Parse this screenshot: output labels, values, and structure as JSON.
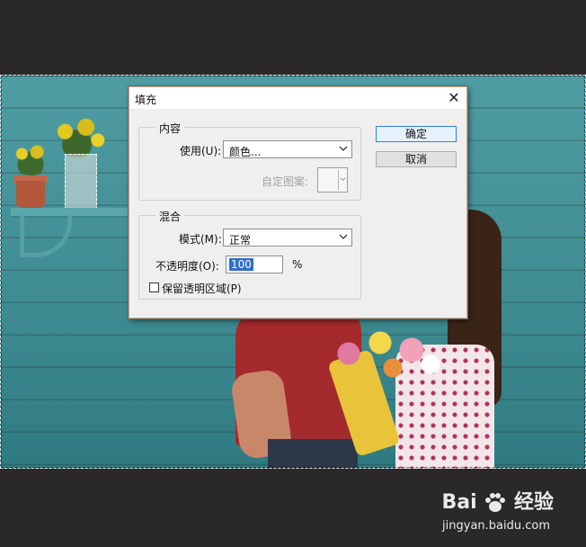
{
  "dialog": {
    "title": "填充",
    "close_glyph": "✕",
    "content_group": {
      "legend": "内容",
      "use_label": "使用(U):",
      "use_value": "颜色...",
      "custom_pattern_label": "自定图案:"
    },
    "blend_group": {
      "legend": "混合",
      "mode_label": "模式(M):",
      "mode_value": "正常",
      "opacity_label": "不透明度(O):",
      "opacity_value": "100",
      "opacity_unit": "%",
      "preserve_label": "保留透明区域(P)",
      "preserve_checked": false
    },
    "buttons": {
      "ok": "确定",
      "cancel": "取消"
    }
  },
  "watermark": {
    "brand": "Bai",
    "brand_suffix": "经验",
    "url": "jingyan.baidu.com"
  },
  "icons": [
    "close-icon",
    "chevron-down-icon",
    "baidu-paw-icon"
  ]
}
